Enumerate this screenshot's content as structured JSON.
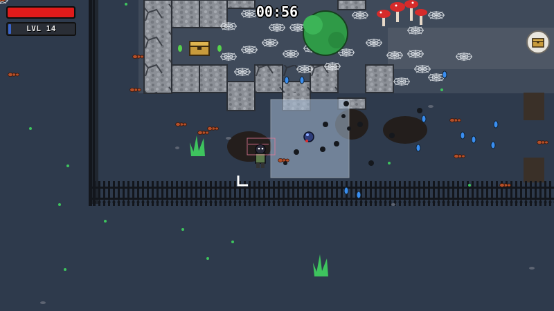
{
  "hud": {
    "timer": "00:56",
    "level_label": "LVL 14",
    "health_fraction": 1.0,
    "xp_fraction": 0.04,
    "health_color": "#e01b1b",
    "xp_color": "#3a64c9"
  },
  "icons": {
    "chest_indicator": "treasure-chest-icon",
    "cursor": "crosshair-icon"
  },
  "colors": {
    "ground": "#2e3a4c",
    "path": "#4a5263",
    "stone": "#8b8f96",
    "fence": "#111419",
    "bush": "#2f9a47",
    "mushroom": "#d62b2b",
    "gem": "#3a8ef0",
    "grass": "#3ec45e",
    "ant": "#b4502a",
    "selection": "#a9bed6"
  }
}
